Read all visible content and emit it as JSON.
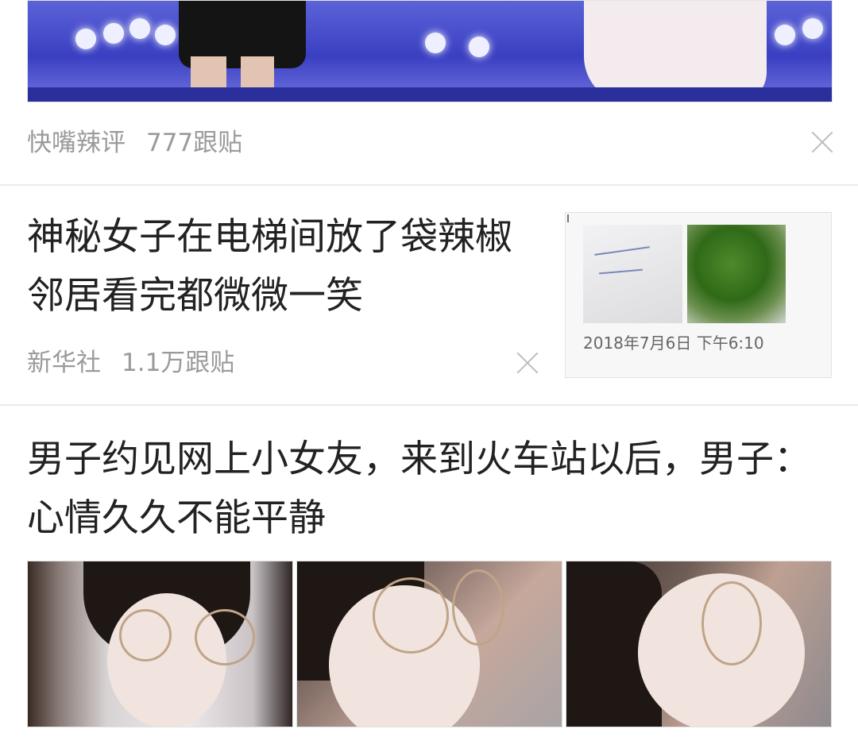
{
  "articles": [
    {
      "source": "快嘴辣评",
      "comments": "777跟贴"
    },
    {
      "title": "神秘女子在电梯间放了袋辣椒 邻居看完都微微一笑",
      "source": "新华社",
      "comments": "1.1万跟贴",
      "thumb_timestamp": "2018年7月6日 下午6:10"
    },
    {
      "title": "男子约见网上小女友，来到火车站以后，男子：心情久久不能平静"
    }
  ],
  "icons": {
    "dismiss": "close-icon"
  },
  "colors": {
    "title": "#222222",
    "meta": "#9a9a9a",
    "divider": "#ececec"
  }
}
